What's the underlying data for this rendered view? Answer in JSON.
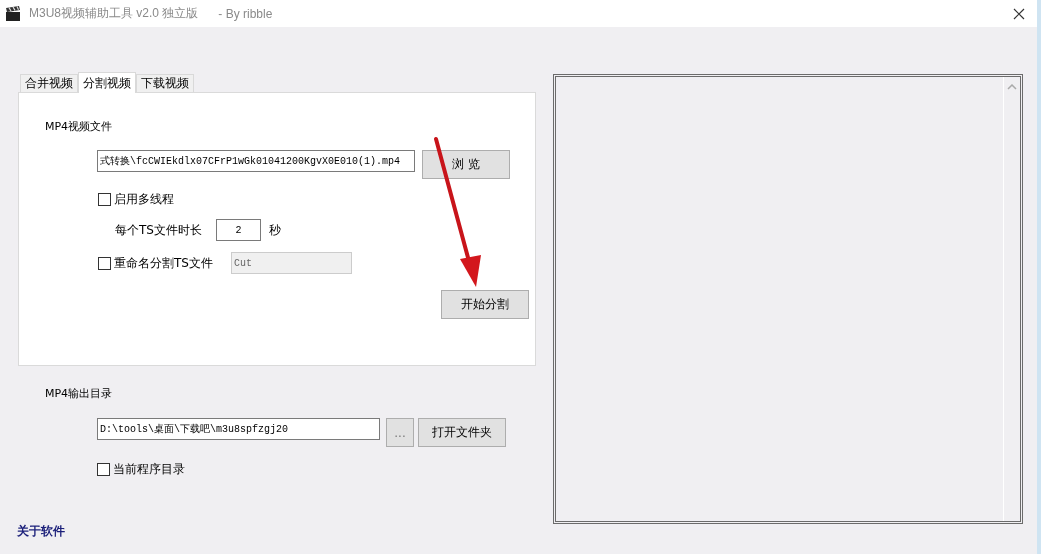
{
  "window": {
    "title": "M3U8视频辅助工具 v2.0 独立版",
    "subtitle": "- By ribble"
  },
  "tabs": [
    {
      "label": "合并视频",
      "selected": false
    },
    {
      "label": "分割视频",
      "selected": true
    },
    {
      "label": "下载视频",
      "selected": false
    }
  ],
  "split_panel": {
    "file_label": "MP4视频文件",
    "file_value": "式转换\\fcCWIEkdlx07CFrP1wGk01041200KgvX0E010(1).mp4",
    "browse_button": "浏 览",
    "multithread": {
      "label": "启用多线程",
      "checked": false
    },
    "duration_label": "每个TS文件时长",
    "duration_value": "2",
    "duration_unit": "秒",
    "rename": {
      "label": "重命名分割TS文件",
      "checked": false
    },
    "rename_value": "Cut",
    "rename_disabled": true,
    "start_button": "开始分割"
  },
  "output": {
    "label": "MP4输出目录",
    "path": "D:\\tools\\桌面\\下载吧\\m3u8spfzgj20",
    "dots_button": "...",
    "open_button": "打开文件夹",
    "current_dir": {
      "label": "当前程序目录",
      "checked": false
    }
  },
  "about_link": "关于软件"
}
